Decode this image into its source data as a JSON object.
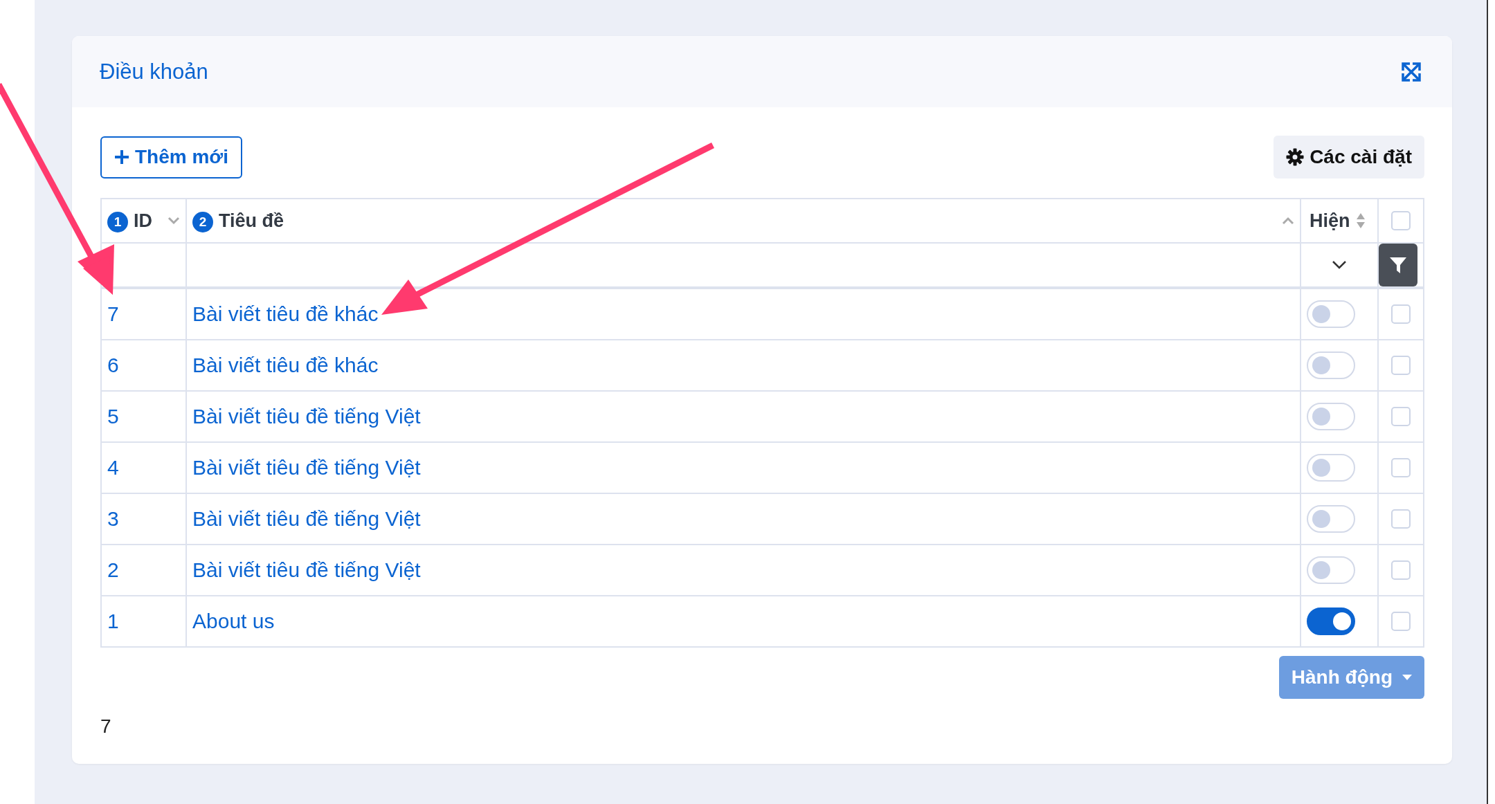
{
  "card": {
    "title": "Điều khoản"
  },
  "toolbar": {
    "add_button": "Thêm mới",
    "settings_button": "Các cài đặt"
  },
  "table": {
    "columns": [
      {
        "label": "ID",
        "sort_order": "1",
        "kind": "desc"
      },
      {
        "label": "Tiêu đề",
        "sort_order": "2",
        "kind": "asc"
      },
      {
        "label": "Hiện",
        "kind": "none"
      }
    ],
    "header_checked": false,
    "rows": [
      {
        "id": "7",
        "title": "Bài viết tiêu đề khác",
        "visible": false,
        "checked": false
      },
      {
        "id": "6",
        "title": "Bài viết tiêu đề khác",
        "visible": false,
        "checked": false
      },
      {
        "id": "5",
        "title": "Bài viết tiêu đề tiếng Việt",
        "visible": false,
        "checked": false
      },
      {
        "id": "4",
        "title": "Bài viết tiêu đề tiếng Việt",
        "visible": false,
        "checked": false
      },
      {
        "id": "3",
        "title": "Bài viết tiêu đề tiếng Việt",
        "visible": false,
        "checked": false
      },
      {
        "id": "2",
        "title": "Bài viết tiêu đề tiếng Việt",
        "visible": false,
        "checked": false
      },
      {
        "id": "1",
        "title": "About us",
        "visible": true,
        "checked": false
      }
    ]
  },
  "action_button": "Hành động",
  "footer_count": "7"
}
